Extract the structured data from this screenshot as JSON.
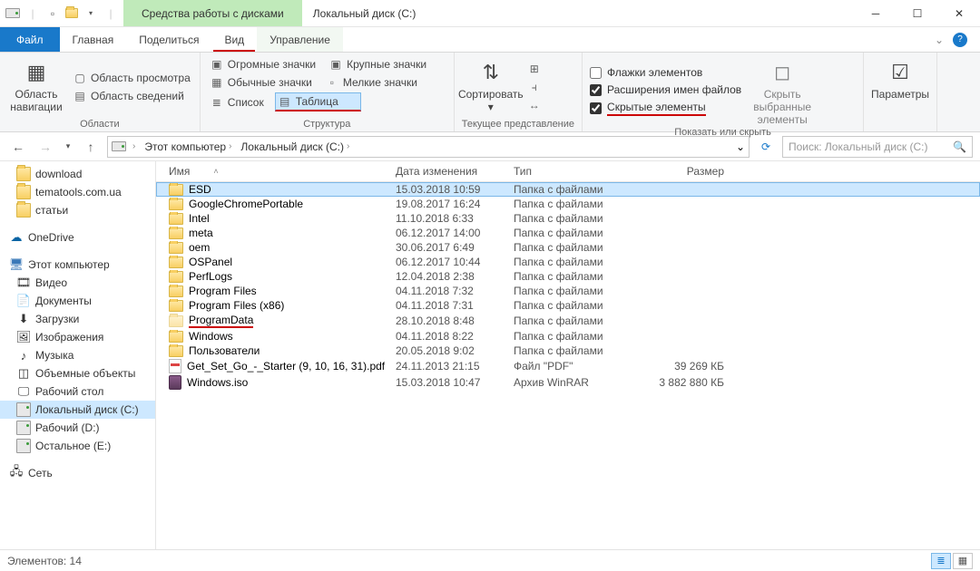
{
  "titlebar": {
    "drive_tools": "Средства работы с дисками",
    "window_title": "Локальный диск (C:)"
  },
  "tabs": {
    "file": "Файл",
    "home": "Главная",
    "share": "Поделиться",
    "view": "Вид",
    "manage": "Управление"
  },
  "ribbon": {
    "nav_pane": "Область навигации",
    "preview_pane": "Область просмотра",
    "details_pane": "Область сведений",
    "panes_label": "Области",
    "xl_icons": "Огромные значки",
    "lg_icons": "Крупные значки",
    "md_icons": "Обычные значки",
    "sm_icons": "Мелкие значки",
    "list": "Список",
    "details": "Таблица",
    "layout_label": "Структура",
    "sort": "Сортировать",
    "current_view_label": "Текущее представление",
    "item_checkboxes": "Флажки элементов",
    "file_ext": "Расширения имен файлов",
    "hidden_items": "Скрытые элементы",
    "hide_selected": "Скрыть выбранные элементы",
    "show_hide_label": "Показать или скрыть",
    "options": "Параметры"
  },
  "breadcrumb": {
    "this_pc": "Этот компьютер",
    "drive": "Локальный диск (C:)"
  },
  "search_placeholder": "Поиск: Локальный диск (C:)",
  "tree": {
    "download": "download",
    "tematools": "tematools.com.ua",
    "articles": "статьи",
    "onedrive": "OneDrive",
    "this_pc": "Этот компьютер",
    "videos": "Видео",
    "documents": "Документы",
    "downloads": "Загрузки",
    "pictures": "Изображения",
    "music": "Музыка",
    "objects3d": "Объемные объекты",
    "desktop": "Рабочий стол",
    "drive_c": "Локальный диск (C:)",
    "drive_d": "Рабочий (D:)",
    "drive_e": "Остальное (E:)",
    "network": "Сеть"
  },
  "columns": {
    "name": "Имя",
    "date": "Дата изменения",
    "type": "Тип",
    "size": "Размер"
  },
  "rows": [
    {
      "name": "ESD",
      "date": "15.03.2018 10:59",
      "type": "Папка с файлами",
      "size": "",
      "icon": "folder",
      "sel": true
    },
    {
      "name": "GoogleChromePortable",
      "date": "19.08.2017 16:24",
      "type": "Папка с файлами",
      "size": "",
      "icon": "folder"
    },
    {
      "name": "Intel",
      "date": "11.10.2018 6:33",
      "type": "Папка с файлами",
      "size": "",
      "icon": "folder"
    },
    {
      "name": "meta",
      "date": "06.12.2017 14:00",
      "type": "Папка с файлами",
      "size": "",
      "icon": "folder"
    },
    {
      "name": "oem",
      "date": "30.06.2017 6:49",
      "type": "Папка с файлами",
      "size": "",
      "icon": "folder"
    },
    {
      "name": "OSPanel",
      "date": "06.12.2017 10:44",
      "type": "Папка с файлами",
      "size": "",
      "icon": "folder"
    },
    {
      "name": "PerfLogs",
      "date": "12.04.2018 2:38",
      "type": "Папка с файлами",
      "size": "",
      "icon": "folder"
    },
    {
      "name": "Program Files",
      "date": "04.11.2018 7:32",
      "type": "Папка с файлами",
      "size": "",
      "icon": "folder"
    },
    {
      "name": "Program Files (x86)",
      "date": "04.11.2018 7:31",
      "type": "Папка с файлами",
      "size": "",
      "icon": "folder"
    },
    {
      "name": "ProgramData",
      "date": "28.10.2018 8:48",
      "type": "Папка с файлами",
      "size": "",
      "icon": "folder-faint",
      "hl": true
    },
    {
      "name": "Windows",
      "date": "04.11.2018 8:22",
      "type": "Папка с файлами",
      "size": "",
      "icon": "folder"
    },
    {
      "name": "Пользователи",
      "date": "20.05.2018 9:02",
      "type": "Папка с файлами",
      "size": "",
      "icon": "folder"
    },
    {
      "name": "Get_Set_Go_-_Starter (9, 10, 16, 31).pdf",
      "date": "24.11.2013 21:15",
      "type": "Файл \"PDF\"",
      "size": "39 269 КБ",
      "icon": "pdf"
    },
    {
      "name": "Windows.iso",
      "date": "15.03.2018 10:47",
      "type": "Архив WinRAR",
      "size": "3 882 880 КБ",
      "icon": "iso"
    }
  ],
  "status": {
    "count": "Элементов: 14"
  }
}
